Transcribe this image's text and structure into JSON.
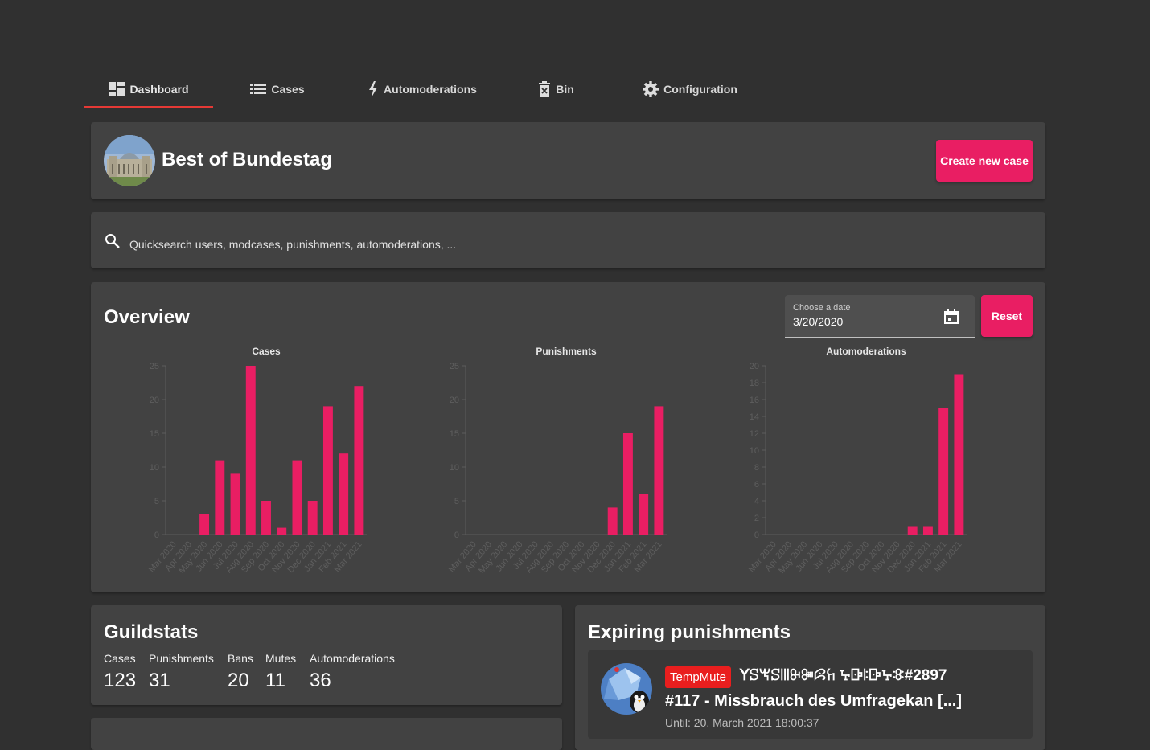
{
  "nav": {
    "tabs": [
      {
        "label": "Dashboard",
        "icon": "dashboard-icon",
        "active": true
      },
      {
        "label": "Cases",
        "icon": "list-icon"
      },
      {
        "label": "Automoderations",
        "icon": "bolt-icon"
      },
      {
        "label": "Bin",
        "icon": "trash-icon"
      },
      {
        "label": "Configuration",
        "icon": "gear-icon"
      }
    ]
  },
  "header": {
    "guild_name": "Best of Bundestag",
    "create_button": "Create new case"
  },
  "search": {
    "placeholder": "Quicksearch users, modcases, punishments, automoderations, ..."
  },
  "overview": {
    "title": "Overview",
    "date_label": "Choose a date",
    "date_value": "3/20/2020",
    "reset_button": "Reset"
  },
  "chart_data": [
    {
      "type": "bar",
      "title": "Cases",
      "categories": [
        "Mar 2020",
        "Apr 2020",
        "May 2020",
        "Jun 2020",
        "Jul 2020",
        "Aug 2020",
        "Sep 2020",
        "Oct 2020",
        "Nov 2020",
        "Dec 2020",
        "Jan 2021",
        "Feb 2021",
        "Mar 2021"
      ],
      "values": [
        0,
        0,
        3,
        11,
        9,
        25,
        5,
        1,
        11,
        5,
        19,
        12,
        22
      ],
      "ylim": [
        0,
        25
      ],
      "yticks": [
        0,
        5,
        10,
        15,
        20,
        25
      ]
    },
    {
      "type": "bar",
      "title": "Punishments",
      "categories": [
        "Mar 2020",
        "Apr 2020",
        "May 2020",
        "Jun 2020",
        "Jul 2020",
        "Aug 2020",
        "Sep 2020",
        "Oct 2020",
        "Nov 2020",
        "Dec 2020",
        "Jan 2021",
        "Feb 2021",
        "Mar 2021"
      ],
      "values": [
        0,
        0,
        0,
        0,
        0,
        0,
        0,
        0,
        0,
        4,
        15,
        6,
        19
      ],
      "ylim": [
        0,
        25
      ],
      "yticks": [
        0,
        5,
        10,
        15,
        20,
        25
      ]
    },
    {
      "type": "bar",
      "title": "Automoderations",
      "categories": [
        "Mar 2020",
        "Apr 2020",
        "May 2020",
        "Jun 2020",
        "Jul 2020",
        "Aug 2020",
        "Sep 2020",
        "Oct 2020",
        "Nov 2020",
        "Dec 2020",
        "Jan 2021",
        "Feb 2021",
        "Mar 2021"
      ],
      "values": [
        0,
        0,
        0,
        0,
        0,
        0,
        0,
        0,
        0,
        1,
        1,
        15,
        19
      ],
      "ylim": [
        0,
        20
      ],
      "yticks": [
        0,
        2,
        4,
        6,
        8,
        10,
        12,
        14,
        16,
        18,
        20
      ]
    }
  ],
  "bar_color": "#e91e63",
  "guildstats": {
    "title": "Guildstats",
    "stats": [
      {
        "label": "Cases",
        "value": "123"
      },
      {
        "label": "Punishments",
        "value": "31"
      },
      {
        "label": "Bans",
        "value": "20"
      },
      {
        "label": "Mutes",
        "value": "11"
      },
      {
        "label": "Automoderations",
        "value": "36"
      }
    ]
  },
  "expiring": {
    "title": "Expiring punishments",
    "items": [
      {
        "tag": "TempMute",
        "user": "ꓬꕶꖙꕶꔖꔬꔼꕸꖷ ꕴꕒꖎꕒꕴꖊ#2897",
        "case_title": "#117 - Missbrauch des Umfragekan [...]",
        "until": "Until: 20. March 2021 18:00:37"
      }
    ]
  }
}
